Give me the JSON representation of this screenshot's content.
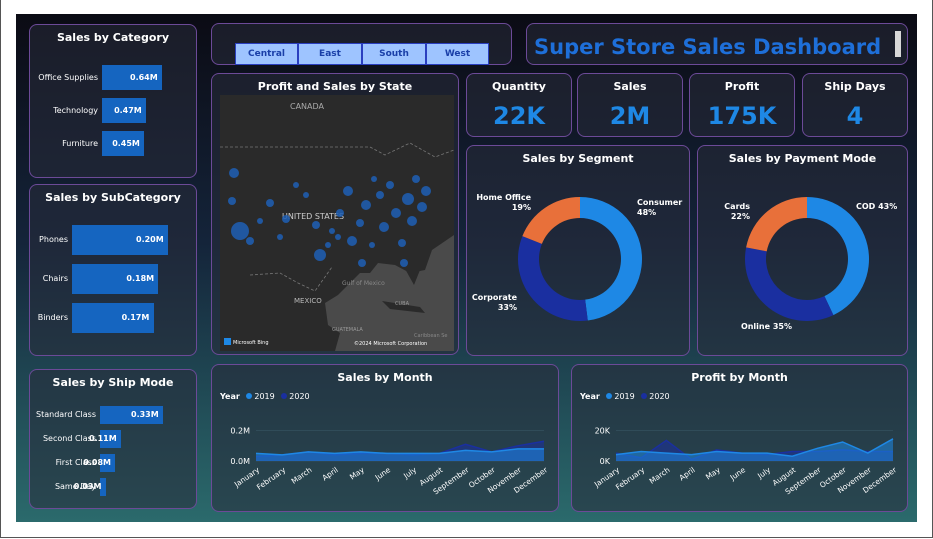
{
  "slicers": [
    "Central",
    "East",
    "South",
    "West"
  ],
  "dashboard_title": "Super Store Sales Dashboard",
  "kpis": [
    {
      "title": "Quantity",
      "value": "22K"
    },
    {
      "title": "Sales",
      "value": "2M"
    },
    {
      "title": "Profit",
      "value": "175K"
    },
    {
      "title": "Ship Days",
      "value": "4"
    }
  ],
  "map": {
    "title": "Profit and Sales by State",
    "labels": {
      "canada": "CANADA",
      "us": "UNITED STATES",
      "mexico": "MEXICO",
      "gulf": "Gulf of Mexico",
      "cuba": "CUBA",
      "guatemala": "GUATEMALA",
      "caribbean": "Caribbean Se"
    },
    "attribution": "Microsoft Bing",
    "copyright": "©2024 Microsoft Corporation"
  },
  "chart_data": [
    {
      "type": "bar",
      "title": "Sales by Category",
      "categories": [
        "Office Supplies",
        "Technology",
        "Furniture"
      ],
      "values": [
        0.64,
        0.47,
        0.45
      ],
      "labels": [
        "0.64M",
        "0.47M",
        "0.45M"
      ]
    },
    {
      "type": "bar",
      "title": "Sales by SubCategory",
      "categories": [
        "Phones",
        "Chairs",
        "Binders"
      ],
      "values": [
        0.2,
        0.18,
        0.17
      ],
      "labels": [
        "0.20M",
        "0.18M",
        "0.17M"
      ]
    },
    {
      "type": "bar",
      "title": "Sales by Ship Mode",
      "categories": [
        "Standard Class",
        "Second Class",
        "First Class",
        "Same Day"
      ],
      "values": [
        0.33,
        0.11,
        0.08,
        0.03
      ],
      "labels": [
        "0.33M",
        "0.11M",
        "0.08M",
        "0.03M"
      ]
    },
    {
      "type": "pie",
      "title": "Sales by Segment",
      "slices": [
        {
          "name": "Consumer",
          "value": 48,
          "label": "48%",
          "color": "#1e88e5"
        },
        {
          "name": "Corporate",
          "value": 33,
          "label": "33%",
          "color": "#1a2fa0"
        },
        {
          "name": "Home Office",
          "value": 19,
          "label": "19%",
          "color": "#e8703a"
        }
      ]
    },
    {
      "type": "pie",
      "title": "Sales by Payment Mode",
      "slices": [
        {
          "name": "COD",
          "value": 43,
          "label": "43%",
          "color": "#1e88e5"
        },
        {
          "name": "Online",
          "value": 35,
          "label": "35%",
          "color": "#1a2fa0"
        },
        {
          "name": "Cards",
          "value": 22,
          "label": "22%",
          "color": "#e8703a"
        }
      ]
    },
    {
      "type": "area",
      "title": "Sales by Month",
      "legend_title": "Year",
      "x": [
        "January",
        "February",
        "March",
        "April",
        "May",
        "June",
        "July",
        "August",
        "September",
        "October",
        "November",
        "December"
      ],
      "yticks": [
        "0.2M",
        "0.0M"
      ],
      "ylim": [
        0,
        0.25
      ],
      "series": [
        {
          "name": "2019",
          "color": "#1e88e5",
          "values": [
            0.05,
            0.04,
            0.06,
            0.05,
            0.06,
            0.05,
            0.05,
            0.05,
            0.07,
            0.06,
            0.08,
            0.08
          ]
        },
        {
          "name": "2020",
          "color": "#1a2fa0",
          "values": [
            0.03,
            0.04,
            0.06,
            0.04,
            0.05,
            0.05,
            0.04,
            0.05,
            0.11,
            0.06,
            0.1,
            0.13
          ]
        }
      ]
    },
    {
      "type": "area",
      "title": "Profit by Month",
      "legend_title": "Year",
      "x": [
        "January",
        "February",
        "March",
        "April",
        "May",
        "June",
        "July",
        "August",
        "September",
        "October",
        "November",
        "December"
      ],
      "yticks": [
        "20K",
        "0K"
      ],
      "ylim": [
        0,
        24000
      ],
      "series": [
        {
          "name": "2019",
          "color": "#1e88e5",
          "values": [
            4000,
            6000,
            5000,
            4000,
            6000,
            5000,
            5000,
            3000,
            8000,
            12000,
            5000,
            14000
          ]
        },
        {
          "name": "2020",
          "color": "#1a2fa0",
          "values": [
            5000,
            2000,
            13000,
            1000,
            7000,
            5000,
            4000,
            6000,
            6000,
            7000,
            6000,
            6000
          ]
        }
      ]
    }
  ]
}
